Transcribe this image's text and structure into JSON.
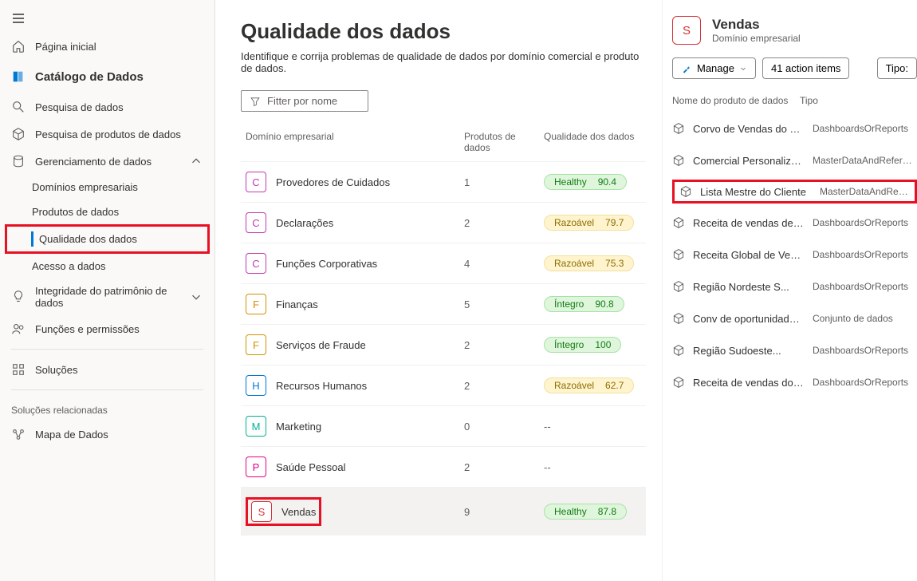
{
  "sidebar": {
    "home": "Página inicial",
    "catalog": "Catálogo de Dados",
    "search_data": "Pesquisa de dados",
    "search_products": "Pesquisa de produtos de dados",
    "data_mgmt": "Gerenciamento de dados",
    "sub": {
      "domains": "Domínios empresariais",
      "products": "Produtos de dados",
      "quality": "Qualidade dos dados",
      "access": "Acesso a dados"
    },
    "integrity": "Integridade do patrimônio de dados",
    "roles": "Funções e permissões",
    "solutions": "Soluções",
    "related_heading": "Soluções relacionadas",
    "data_map": "Mapa de Dados"
  },
  "page": {
    "title": "Qualidade dos dados",
    "subtitle": "Identifique e corrija problemas de qualidade de dados por domínio comercial e produto de dados.",
    "filter_placeholder": "Fitter por nome"
  },
  "table": {
    "headers": {
      "domain": "Domínio empresarial",
      "products": "Produtos de dados",
      "quality": "Qualidade dos dados"
    },
    "rows": [
      {
        "letter": "C",
        "cls": "c",
        "name": "Provedores de Cuidados",
        "products": "1",
        "pill": "green",
        "status": "Healthy",
        "score": "90.4"
      },
      {
        "letter": "C",
        "cls": "c",
        "name": "Declarações",
        "products": "2",
        "pill": "yellow",
        "status": "Razoável",
        "score": "79.7"
      },
      {
        "letter": "C",
        "cls": "c",
        "name": "Funções Corporativas",
        "products": "4",
        "pill": "yellow",
        "status": "Razoável",
        "score": "75.3"
      },
      {
        "letter": "F",
        "cls": "f",
        "name": "Finanças",
        "products": "5",
        "pill": "green",
        "status": "Íntegro",
        "score": "90.8"
      },
      {
        "letter": "F",
        "cls": "f",
        "name": "Serviços de Fraude",
        "products": "2",
        "pill": "green",
        "status": "Íntegro",
        "score": "100"
      },
      {
        "letter": "H",
        "cls": "h",
        "name": "Recursos Humanos",
        "products": "2",
        "pill": "yellow",
        "status": "Razoável",
        "score": "62.7"
      },
      {
        "letter": "M",
        "cls": "m",
        "name": "Marketing",
        "products": "0",
        "pill": "",
        "status": "--",
        "score": ""
      },
      {
        "letter": "P",
        "cls": "p",
        "name": "Saúde Pessoal",
        "products": "2",
        "pill": "",
        "status": "--",
        "score": ""
      },
      {
        "letter": "S",
        "cls": "s",
        "name": "Vendas",
        "products": "9",
        "pill": "green",
        "status": "Healthy",
        "score": "87.8"
      }
    ]
  },
  "detail": {
    "title": "Vendas",
    "subtitle": "Domínio empresarial",
    "manage": "Manage",
    "action_items": "41 action items",
    "type_label": "Tipo:",
    "headers": {
      "name": "Nome do produto de dados",
      "type": "Tipo"
    },
    "items": [
      {
        "name": "Corvo de Vendas do Canadá",
        "type": "DashboardsOrReports"
      },
      {
        "name": "Comercial Personalizado...",
        "type": "MasterDataAndReferen..."
      },
      {
        "name": "Lista Mestre do Cliente",
        "type": "MasterDataAndReferen..."
      },
      {
        "name": "Receita de vendas de DE em...",
        "type": "DashboardsOrReports"
      },
      {
        "name": "Receita Global de Vendas",
        "type": "DashboardsOrReports"
      },
      {
        "name": "Região Nordeste S...",
        "type": "DashboardsOrReports"
      },
      {
        "name": "Conv de oportunidades...",
        "type": "Conjunto de dados"
      },
      {
        "name": "Região Sudoeste...",
        "type": "DashboardsOrReports"
      },
      {
        "name": "Receita de vendas dos EUA em...",
        "type": "DashboardsOrReports"
      }
    ]
  }
}
